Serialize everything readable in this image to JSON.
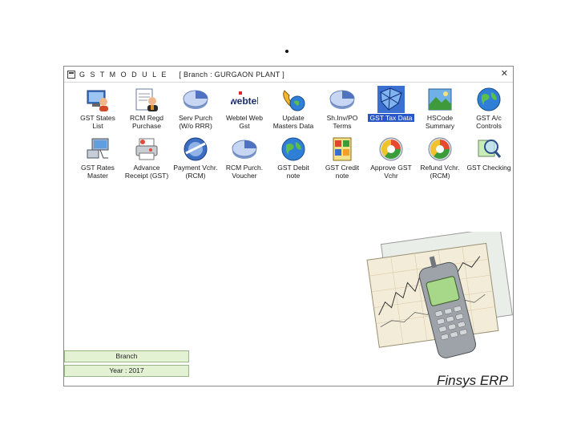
{
  "window": {
    "title": "G S T   M O D U L E",
    "branch": "[ Branch : GURGAON PLANT ]",
    "close_glyph": "✕"
  },
  "tiles": [
    {
      "label": "GST States\nList",
      "icon": "workstation-users-icon"
    },
    {
      "label": "RCM Regd\nPurchase",
      "icon": "document-user-icon"
    },
    {
      "label": "Serv Purch\n(W/o RRR)",
      "icon": "pie-chart-icon"
    },
    {
      "label": "Webtel Web\nGst",
      "icon": "webtel-logo-icon"
    },
    {
      "label": "Update\nMasters Data",
      "icon": "phone-globe-icon"
    },
    {
      "label": "Sh.Inv/PO\nTerms",
      "icon": "pie-chart-icon"
    },
    {
      "label": "GST Tax Data",
      "icon": "network-grid-icon",
      "selected": true
    },
    {
      "label": "HSCode\nSummary",
      "icon": "landscape-icon"
    },
    {
      "label": "GST A/c\nControls",
      "icon": "globe-icon"
    },
    {
      "label": "GST Rates\nMaster",
      "icon": "computer-network-icon"
    },
    {
      "label": "Advance\nReceipt (GST)",
      "icon": "printer-icon"
    },
    {
      "label": "Payment Vchr.\n(RCM)",
      "icon": "globe-disc-icon"
    },
    {
      "label": "RCM Purch.\nVoucher",
      "icon": "pie-chart-icon"
    },
    {
      "label": "GST Debit\nnote",
      "icon": "globe-icon"
    },
    {
      "label": "GST Credit\nnote",
      "icon": "palette-icon"
    },
    {
      "label": "Approve GST\nVchr",
      "icon": "recycle-globe-icon"
    },
    {
      "label": "Refund Vchr.\n(RCM)",
      "icon": "recycle-globe-icon"
    },
    {
      "label": "GST Checking",
      "icon": "magnifier-icon"
    }
  ],
  "side_panel": {
    "branch_label": "Branch",
    "year_label": "Year : 2017"
  },
  "branding": {
    "name": "Finsys ERP",
    "accent": "#3a6fd8"
  }
}
